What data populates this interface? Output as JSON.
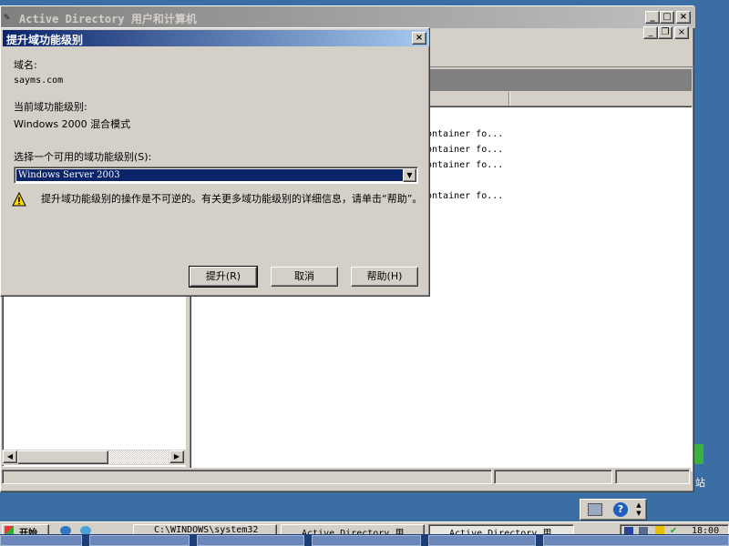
{
  "main_window": {
    "title": "Active Directory 用户和计算机",
    "buttons": {
      "minimize": "_",
      "maximize": "□",
      "close": "×"
    },
    "inner_buttons": {
      "minimize": "_",
      "restore": "❐",
      "close": "×"
    },
    "list_rows": [
      "ontainer fo...",
      "ontainer fo...",
      "ontainer fo...",
      "ontainer fo..."
    ]
  },
  "dialog": {
    "title": "提升域功能级别",
    "close": "×",
    "domain_label": "域名:",
    "domain_value": "sayms.com",
    "current_level_label": "当前域功能级别:",
    "current_level_value": "Windows 2000 混合模式",
    "select_label": "选择一个可用的域功能级别(S):",
    "select_value": "Windows Server 2003",
    "select_arrow": "▼",
    "warning_text": "提升域功能级别的操作是不可逆的。有关更多域功能级别的详细信息，请单击“帮助”。",
    "buttons": {
      "raise": "提升(R)",
      "cancel": "取消",
      "help": "帮助(H)"
    }
  },
  "scrollbar": {
    "left_arrow": "◀",
    "right_arrow": "▶"
  },
  "taskbar": {
    "start": "开始",
    "items": [
      "C:\\WINDOWS\\system32",
      "Active Directory 用",
      "Active Directory 用"
    ],
    "clock": "18:00"
  },
  "tray_popup": {
    "help": "?"
  },
  "desktop": {
    "recycle_label": "站"
  }
}
